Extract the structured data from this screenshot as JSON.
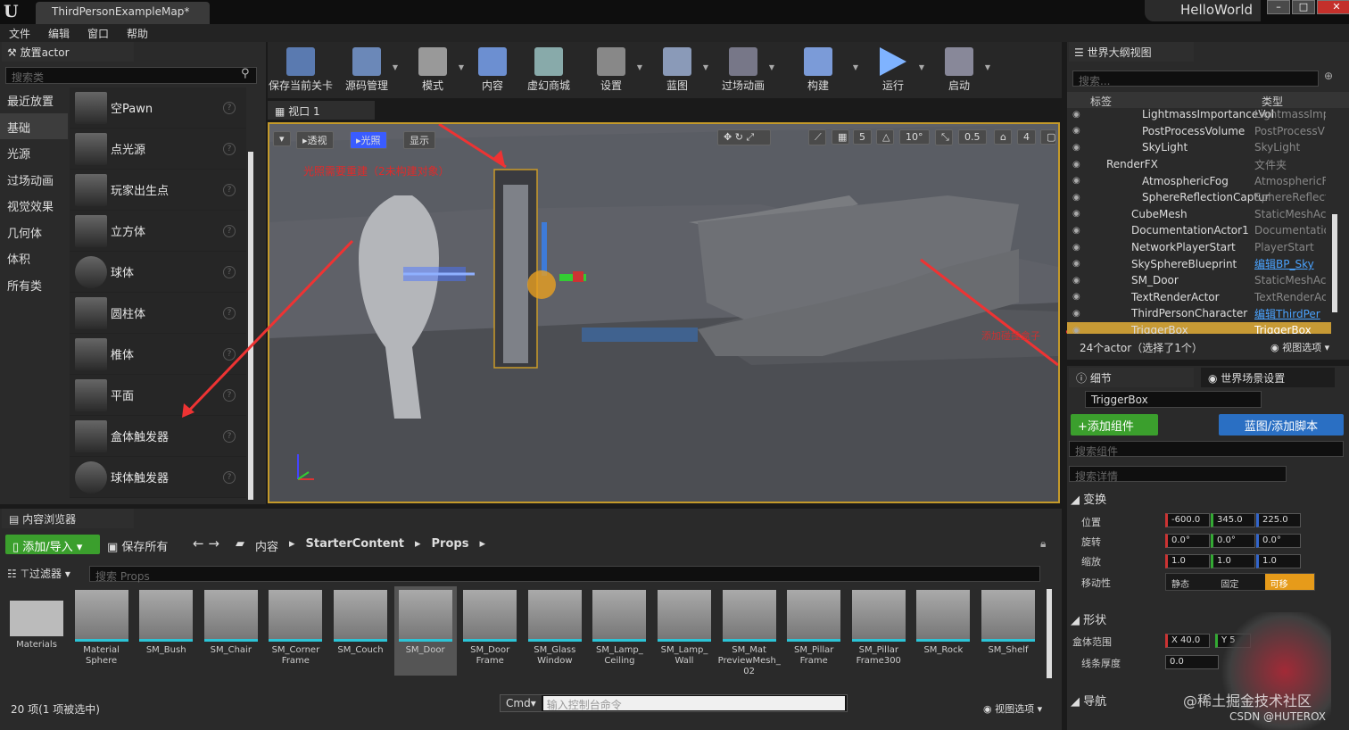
{
  "window": {
    "tab_title": "ThirdPersonExampleMap",
    "dirty_mark": "*",
    "project": "HelloWorld"
  },
  "menu": [
    "文件",
    "编辑",
    "窗口",
    "帮助"
  ],
  "place_actor": {
    "title": "放置actor",
    "search_placeholder": "搜索类",
    "categories": [
      "最近放置",
      "基础",
      "光源",
      "过场动画",
      "视觉效果",
      "几何体",
      "体积",
      "所有类"
    ],
    "items": [
      "空Pawn",
      "点光源",
      "玩家出生点",
      "立方体",
      "球体",
      "圆柱体",
      "椎体",
      "平面",
      "盒体触发器",
      "球体触发器"
    ]
  },
  "toolbar": [
    "保存当前关卡",
    "源码管理",
    "模式",
    "内容",
    "虚幻商城",
    "设置",
    "蓝图",
    "过场动画",
    "构建",
    "运行",
    "启动"
  ],
  "viewport": {
    "tab": "视口 1",
    "btn_persp": "透视",
    "btn_lit": "光照",
    "btn_show": "显示",
    "warning": "光照需要重建（2未构建对象）",
    "grid": "5",
    "angle": "10°",
    "scale": "0.5",
    "cam": "4",
    "annotation": "添加碰撞盒子"
  },
  "outliner": {
    "title": "世界大纲视图",
    "search_placeholder": "搜索...",
    "col_label": "标签",
    "col_type": "类型",
    "rows": [
      {
        "name": "LightmassImportanceVol",
        "type": "LightmassImp",
        "indent": 1
      },
      {
        "name": "PostProcessVolume",
        "type": "PostProcessV",
        "indent": 1
      },
      {
        "name": "SkyLight",
        "type": "SkyLight",
        "indent": 1
      },
      {
        "name": "RenderFX",
        "type": "文件夹",
        "indent": 0,
        "folder": true
      },
      {
        "name": "AtmosphericFog",
        "type": "AtmosphericF",
        "indent": 1
      },
      {
        "name": "SphereReflectionCaptur",
        "type": "SphereReflecti",
        "indent": 1
      },
      {
        "name": "CubeMesh",
        "type": "StaticMeshAct",
        "indent": 0
      },
      {
        "name": "DocumentationActor1",
        "type": "Documentatio",
        "indent": 0
      },
      {
        "name": "NetworkPlayerStart",
        "type": "PlayerStart",
        "indent": 0
      },
      {
        "name": "SkySphereBlueprint",
        "type": "编辑BP_Sky",
        "indent": 0,
        "link": true
      },
      {
        "name": "SM_Door",
        "type": "StaticMeshAct",
        "indent": 0
      },
      {
        "name": "TextRenderActor",
        "type": "TextRenderAct",
        "indent": 0
      },
      {
        "name": "ThirdPersonCharacter",
        "type": "编辑ThirdPer",
        "indent": 0,
        "link": true
      },
      {
        "name": "TriggerBox",
        "type": "TriggerBox",
        "indent": 0,
        "sel": true
      }
    ],
    "footer": "24个actor（选择了1个）",
    "view_options": "视图选项"
  },
  "details": {
    "tab": "细节",
    "tab2": "世界场景设置",
    "name": "TriggerBox",
    "add_component": "+添加组件",
    "blueprint": "蓝图/添加脚本",
    "search_comp": "搜索组件",
    "search_detail": "搜索详情",
    "transform": "变换",
    "loc": "位置",
    "rot": "旋转",
    "scale": "缩放",
    "mobility": "移动性",
    "loc_vals": [
      "-600.0",
      "345.0",
      "225.0"
    ],
    "rot_vals": [
      "0.0°",
      "0.0°",
      "0.0°"
    ],
    "scale_vals": [
      "1.0",
      "1.0",
      "1.0"
    ],
    "mob": [
      "静态",
      "固定",
      "可移"
    ],
    "shape": "形状",
    "extent": "盒体范围",
    "extent_x": "X 40.0",
    "extent_y": "Y 5",
    "line": "线条厚度",
    "line_val": "0.0",
    "nav": "导航"
  },
  "content": {
    "title": "内容浏览器",
    "add": "添加/导入",
    "save": "保存所有",
    "path": [
      "内容",
      "StarterContent",
      "Props"
    ],
    "filter": "过滤器",
    "search_placeholder": "搜索 Props",
    "assets": [
      "Materials",
      "Material Sphere",
      "SM_Bush",
      "SM_Chair",
      "SM_Corner Frame",
      "SM_Couch",
      "SM_Door",
      "SM_Door Frame",
      "SM_Glass Window",
      "SM_Lamp_ Ceiling",
      "SM_Lamp_ Wall",
      "SM_Mat PreviewMesh_ 02",
      "SM_Pillar Frame",
      "SM_Pillar Frame300",
      "SM_Rock",
      "SM_Shelf"
    ],
    "status": "20 项(1 项被选中)",
    "cmd": "Cmd",
    "cmd_placeholder": "输入控制台命令",
    "view_options": "视图选项"
  },
  "watermark": "@稀土掘金技术社区",
  "watermark2": "CSDN @HUTEROX"
}
